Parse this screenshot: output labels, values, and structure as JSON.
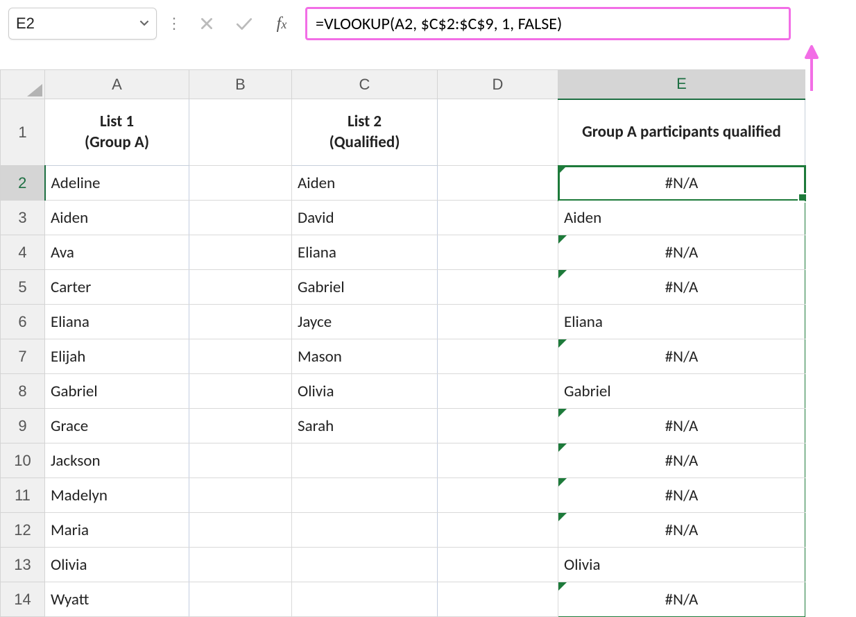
{
  "nameBox": "E2",
  "formula": "=VLOOKUP(A2, $C$2:$C$9, 1, FALSE)",
  "columns": [
    "A",
    "B",
    "C",
    "D",
    "E"
  ],
  "activeColumn": "E",
  "activeRow": 2,
  "headers": {
    "A": "List 1\n(Group A)",
    "C": "List 2\n(Qualified)",
    "E": "Group A participants qualified"
  },
  "rows": [
    {
      "n": 2,
      "A": "Adeline",
      "C": "Aiden",
      "E": "#N/A",
      "Eerr": true,
      "Ealign": "center",
      "sel": true
    },
    {
      "n": 3,
      "A": "Aiden",
      "C": "David",
      "E": "Aiden",
      "Eerr": false,
      "Ealign": "left"
    },
    {
      "n": 4,
      "A": "Ava",
      "C": "Eliana",
      "E": "#N/A",
      "Eerr": true,
      "Ealign": "center"
    },
    {
      "n": 5,
      "A": "Carter",
      "C": "Gabriel",
      "E": "#N/A",
      "Eerr": true,
      "Ealign": "center"
    },
    {
      "n": 6,
      "A": "Eliana",
      "C": "Jayce",
      "E": "Eliana",
      "Eerr": false,
      "Ealign": "left"
    },
    {
      "n": 7,
      "A": "Elijah",
      "C": "Mason",
      "E": "#N/A",
      "Eerr": true,
      "Ealign": "center"
    },
    {
      "n": 8,
      "A": "Gabriel",
      "C": "Olivia",
      "E": "Gabriel",
      "Eerr": false,
      "Ealign": "left"
    },
    {
      "n": 9,
      "A": "Grace",
      "C": "Sarah",
      "E": "#N/A",
      "Eerr": true,
      "Ealign": "center"
    },
    {
      "n": 10,
      "A": "Jackson",
      "C": "",
      "E": "#N/A",
      "Eerr": true,
      "Ealign": "center"
    },
    {
      "n": 11,
      "A": "Madelyn",
      "C": "",
      "E": "#N/A",
      "Eerr": true,
      "Ealign": "center"
    },
    {
      "n": 12,
      "A": "Maria",
      "C": "",
      "E": "#N/A",
      "Eerr": true,
      "Ealign": "center"
    },
    {
      "n": 13,
      "A": "Olivia",
      "C": "",
      "E": "Olivia",
      "Eerr": false,
      "Ealign": "left"
    },
    {
      "n": 14,
      "A": "Wyatt",
      "C": "",
      "E": "#N/A",
      "Eerr": true,
      "Ealign": "center"
    }
  ]
}
